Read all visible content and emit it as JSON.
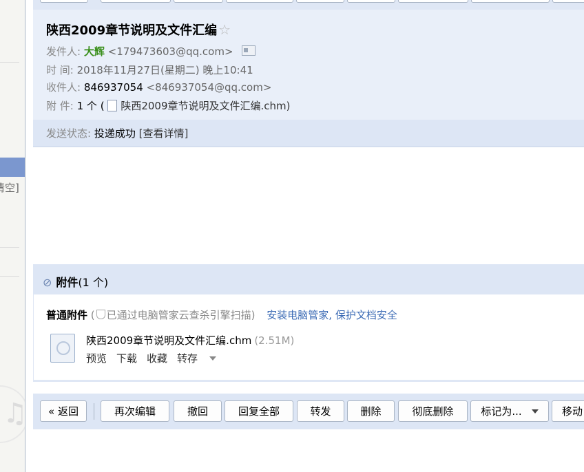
{
  "sidebar": {
    "partial_text": "清空]"
  },
  "email": {
    "subject": "陕西2009章节说明及文件汇编",
    "from_label": "发件人:",
    "from_name": "大辉",
    "from_addr": "<179473603@qq.com>",
    "time_label": "时 间:",
    "time_value": "2018年11月27日(星期二) 晚上10:41",
    "to_label": "收件人:",
    "to_name": "846937054",
    "to_addr": "<846937054@qq.com>",
    "att_label": "附 件:",
    "att_count_prefix": "1 个 (",
    "att_file": "陕西2009章节说明及文件汇编.chm",
    "att_count_suffix": ")",
    "status_label": "发送状态:",
    "status_value": "投递成功",
    "status_link": "[查看详情]"
  },
  "attachments": {
    "title": "附件",
    "count": "(1 个)",
    "kind": "普通附件",
    "scan_open": "(",
    "scan_text": "已通过电脑管家云查杀引擎扫描)",
    "install_text": "安装电脑管家, 保护文档安全",
    "file_name": "陕西2009章节说明及文件汇编.chm",
    "file_size": "(2.51M)",
    "actions": {
      "preview": "预览",
      "download": "下载",
      "favorite": "收藏",
      "save_to": "转存"
    }
  },
  "toolbar": {
    "back": "« 返回",
    "edit_again": "再次编辑",
    "recall": "撤回",
    "reply_all": "回复全部",
    "forward": "转发",
    "delete": "删除",
    "delete_permanent": "彻底删除",
    "mark_as": "标记为...",
    "move": "移动"
  }
}
